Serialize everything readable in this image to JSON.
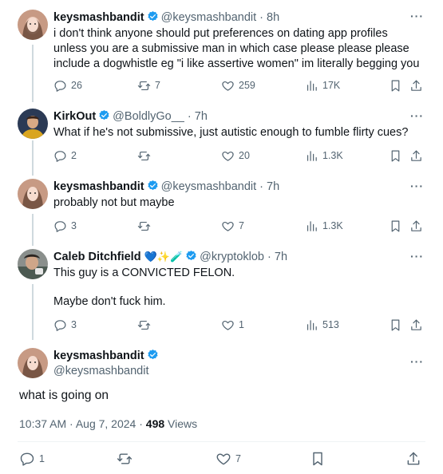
{
  "tweets": [
    {
      "name": "keysmashbandit",
      "handle": "@keysmashbandit",
      "time": "8h",
      "text": "i don't think anyone should put preferences on dating app profiles unless you are a submissive man in which case please please please include a dogwhistle eg \"i like assertive women\" im literally begging you",
      "replies": "26",
      "reposts": "7",
      "likes": "259",
      "views": "17K"
    },
    {
      "name": "KirkOut",
      "handle": "@BoldlyGo__",
      "time": "7h",
      "text": "What if he's not submissive, just autistic enough to fumble flirty cues?",
      "replies": "2",
      "reposts": "",
      "likes": "20",
      "views": "1.3K"
    },
    {
      "name": "keysmashbandit",
      "handle": "@keysmashbandit",
      "time": "7h",
      "text": "probably not but maybe",
      "replies": "3",
      "reposts": "",
      "likes": "7",
      "views": "1.3K"
    },
    {
      "name": "Caleb Ditchfield",
      "name_emoji": "💙✨🧪",
      "handle": "@kryptoklob",
      "time": "7h",
      "text_line1": "This guy is a CONVICTED FELON.",
      "text_line2": "Maybe don't fuck him.",
      "replies": "3",
      "reposts": "",
      "likes": "1",
      "views": "513"
    }
  ],
  "main_tweet": {
    "name": "keysmashbandit",
    "handle": "@keysmashbandit",
    "text": "what is going on",
    "timestamp": "10:37 AM · Aug 7, 2024 ·",
    "views_count": "498",
    "views_label": "Views",
    "replies": "1",
    "reposts": "",
    "likes": "7"
  },
  "ui": {
    "dot": "·",
    "more": "···"
  },
  "colors": {
    "verified": "#1d9bf0",
    "muted": "#536471",
    "text": "#0f1419",
    "line": "#cfd9de"
  },
  "icons": [
    "reply-icon",
    "repost-icon",
    "like-icon",
    "views-icon",
    "bookmark-icon",
    "share-icon",
    "verified-icon",
    "more-icon"
  ]
}
